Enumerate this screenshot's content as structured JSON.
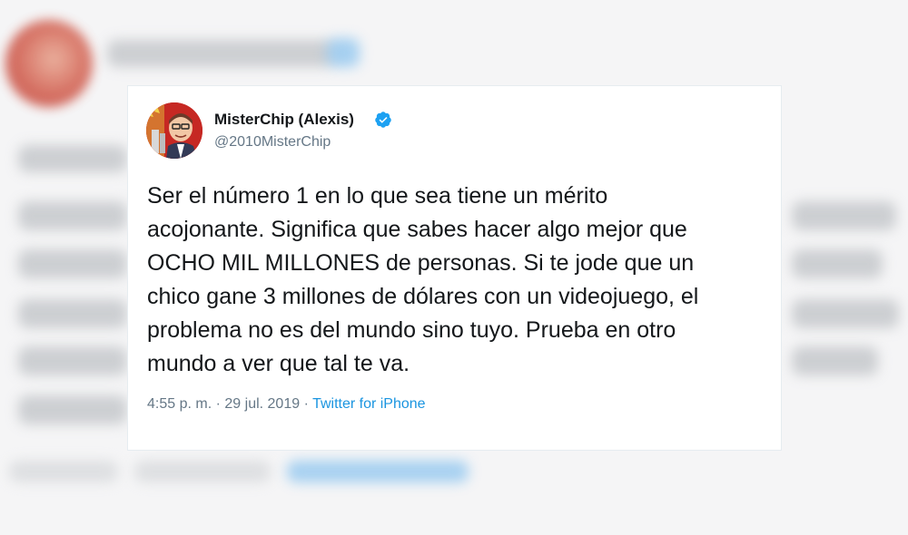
{
  "tweet": {
    "display_name": "MisterChip (Alexis)",
    "handle": "@2010MisterChip",
    "text": "Ser el número 1 en lo que sea tiene un mérito\nacojonante. Significa que sabes hacer algo mejor que\nOCHO MIL MILLONES de personas. Si te jode que un\nchico gane 3 millones de dólares con un videojuego, el\nproblema no es del mundo sino tuyo. Prueba en otro\nmundo a ver que tal te va.",
    "time": "4:55 p. m.",
    "separator": "·",
    "date": "29 jul. 2019",
    "source": "Twitter for iPhone"
  },
  "colors": {
    "verified_badge": "#1da1f2",
    "link": "#1b95e0",
    "secondary_text": "#657786",
    "primary_text": "#14171a"
  },
  "icons": {
    "verified": "verified-badge-icon",
    "avatar": "profile-avatar"
  }
}
